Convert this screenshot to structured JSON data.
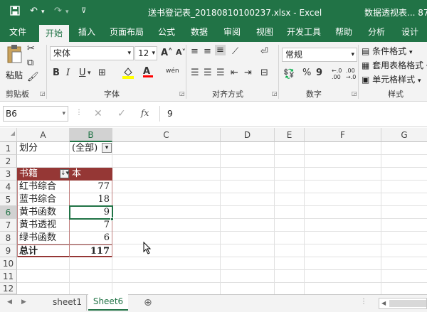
{
  "titlebar": {
    "save_icon": "save-icon",
    "undo_icon": "undo-icon",
    "redo_icon": "redo-icon",
    "customize_icon": "customize-icon",
    "title": "送书登记表_20180810100237.xlsx  -  Excel",
    "right_text": "数据透视表...  87"
  },
  "tabs": [
    "文件",
    "开始",
    "插入",
    "页面布局",
    "公式",
    "数据",
    "审阅",
    "视图",
    "开发工具",
    "帮助",
    "分析",
    "设计"
  ],
  "ribbon": {
    "paste_label": "粘贴",
    "font_name": "宋体",
    "font_size": "12",
    "grow_font": "A˄",
    "shrink_font": "A˅",
    "bold": "B",
    "italic": "I",
    "underline": "U",
    "phonetic": "wén",
    "number_format": "常规",
    "percent": "%",
    "comma": "9",
    "cond_format": "条件格式",
    "table_format": "套用表格格式",
    "cell_styles": "单元格样式",
    "groups": {
      "clipboard": "剪贴板",
      "font": "字体",
      "align": "对齐方式",
      "number": "数字",
      "styles": "样式"
    }
  },
  "formula_bar": {
    "name_box": "B6",
    "fx": "fx",
    "value": "9"
  },
  "grid": {
    "columns": [
      "A",
      "B",
      "C",
      "D",
      "E",
      "F",
      "G"
    ],
    "rows": [
      "1",
      "2",
      "3",
      "4",
      "5",
      "6",
      "7",
      "8",
      "9",
      "10",
      "11",
      "12"
    ],
    "filter_label": "划分",
    "filter_value": "(全部)",
    "pivot_header_1": "书籍",
    "pivot_header_2": "本",
    "records": [
      {
        "name": "红书综合",
        "value": "77"
      },
      {
        "name": "蓝书综合",
        "value": "18"
      },
      {
        "name": "黄书函数",
        "value": "9"
      },
      {
        "name": "黄书透视",
        "value": "7"
      },
      {
        "name": "绿书函数",
        "value": "6"
      }
    ],
    "total_label": "总计",
    "total_value": "117"
  },
  "sheets": [
    "sheet1",
    "Sheet6"
  ],
  "add_sheet": "⊕",
  "colors": {
    "excel_green": "#217346",
    "pivot_header": "#953735"
  }
}
